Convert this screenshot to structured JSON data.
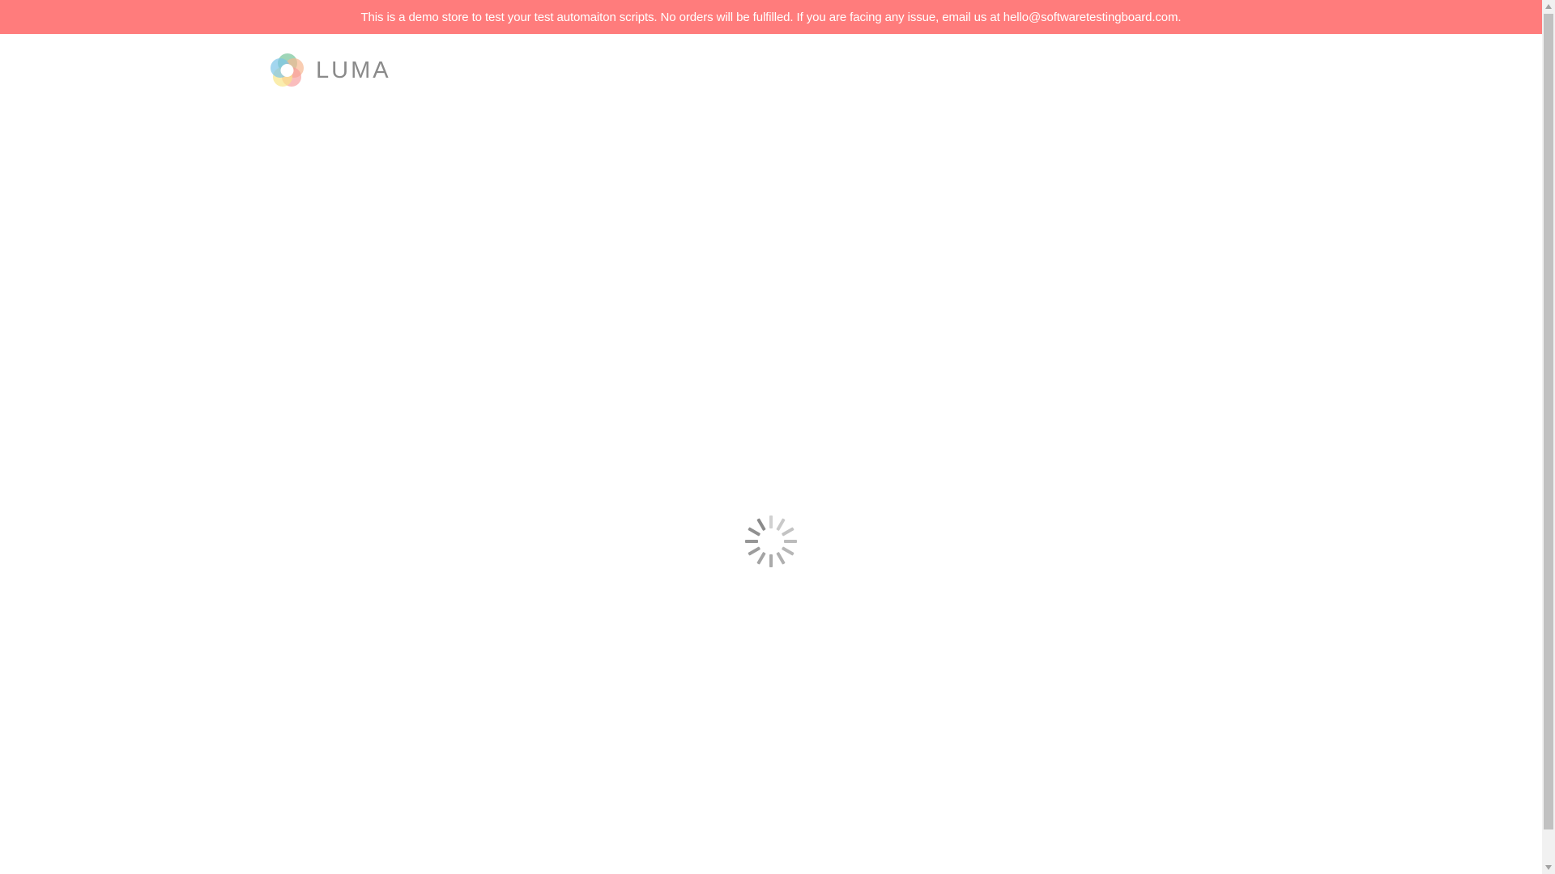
{
  "banner": {
    "text": "This is a demo store to test your test automaiton scripts. No orders will be fulfilled. If you are facing any issue, email us at hello@softwaretestingboard.com."
  },
  "header": {
    "logo_text": "LUMA",
    "logo_icon": "luma-logo-mark"
  },
  "main": {
    "loading_icon": "spinner-icon"
  },
  "scrollbar": {
    "up_icon": "triangle-up-icon",
    "down_icon": "triangle-down-icon"
  },
  "colors": {
    "banner_bg": "#ff7c7c",
    "banner_text": "#ffffff",
    "logo_text": "#8a8a8a",
    "spinner": "#8a8a8a",
    "background": "#ffffff"
  }
}
